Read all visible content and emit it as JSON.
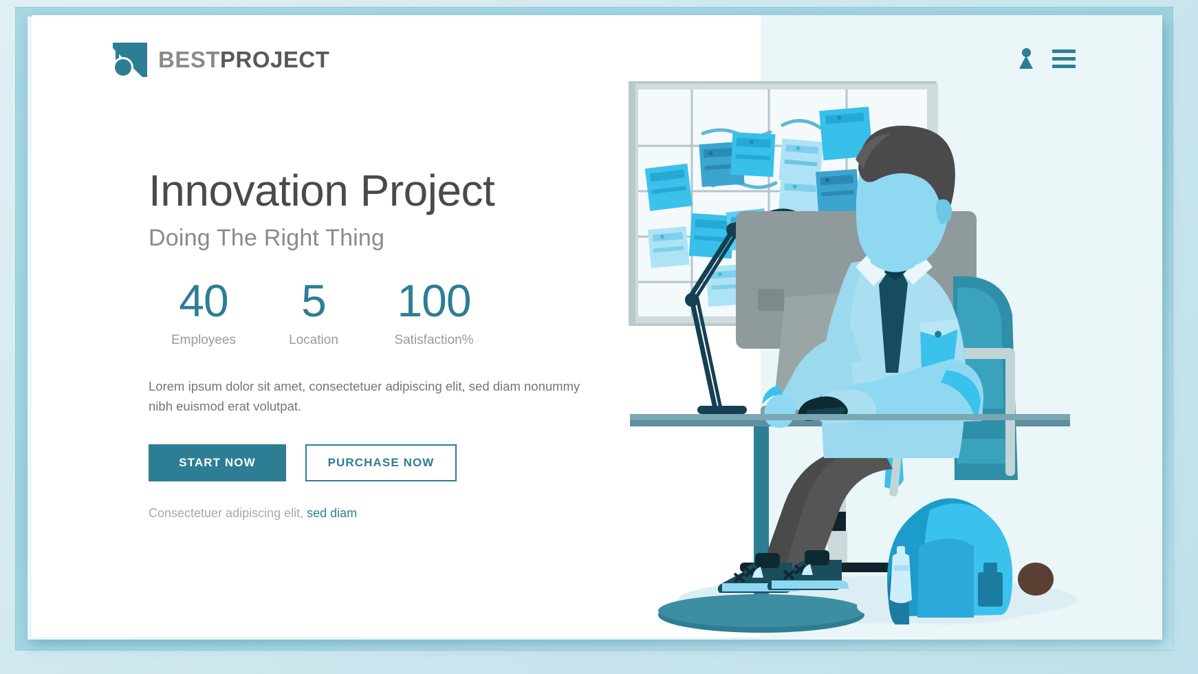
{
  "brand": {
    "logo_icon": "triangle-circle-logo-icon",
    "name_part1": "BEST",
    "name_part2": "PROJECT"
  },
  "header": {
    "user_icon": "user-icon",
    "menu_icon": "hamburger-menu-icon"
  },
  "hero": {
    "title": "Innovation Project",
    "subtitle": "Doing The Right Thing",
    "stats": [
      {
        "value": "40",
        "label": "Employees"
      },
      {
        "value": "5",
        "label": "Location"
      },
      {
        "value": "100",
        "label": "Satisfaction%"
      }
    ],
    "paragraph": "Lorem ipsum dolor sit amet, consectetuer adipiscing elit, sed diam nonummy nibh euismod erat volutpat.",
    "primary_button": "START NOW",
    "secondary_button": "PURCHASE NOW",
    "footnote_text": "Consectetuer adipiscing elit, ",
    "footnote_link": "sed diam"
  },
  "illustration": {
    "name": "man-at-desk-with-kanban-board-illustration",
    "elements": [
      "whiteboard-with-sticky-notes",
      "desk-lamp",
      "desktop-monitor",
      "keyboard",
      "computer-mouse",
      "office-chair",
      "seated-man",
      "backpack-with-water-bottle"
    ]
  },
  "colors": {
    "accent": "#2d7d95",
    "accent_light": "#3bbfe8",
    "sky": "#8fd8f2",
    "pale_bg": "#eaf6f8",
    "frame": "#a9d8e4",
    "text_dark": "#4a4a4a",
    "text_muted": "#8a8a8a",
    "grey": "#9a9a9a",
    "monitor_grey": "#8e9a9c",
    "trousers": "#4a4a4a"
  }
}
